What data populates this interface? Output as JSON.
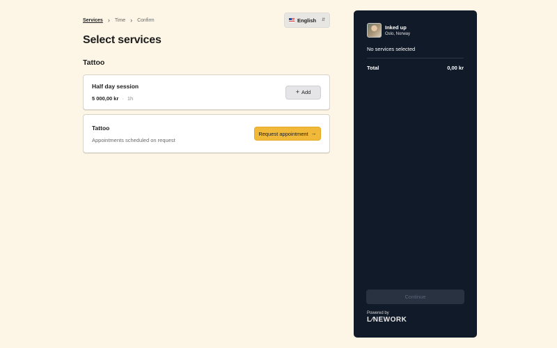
{
  "breadcrumb": {
    "items": [
      {
        "label": "Services",
        "active": true
      },
      {
        "label": "Time",
        "active": false
      },
      {
        "label": "Confirm",
        "active": false
      }
    ],
    "separator": "›"
  },
  "language": {
    "selected": "English",
    "icon": "us-flag-icon",
    "toggle_icon": "up-down-chevron-icon"
  },
  "page_title": "Select services",
  "section": {
    "title": "Tattoo"
  },
  "services": [
    {
      "title": "Half day session",
      "price": "5 000,00 kr",
      "separator": "·",
      "duration": "1h",
      "action_label": "Add",
      "action_icon": "+"
    },
    {
      "title": "Tattoo",
      "description": "Appointments scheduled on request",
      "action_label": "Request appointment",
      "action_icon": "→"
    }
  ],
  "summary": {
    "business_name": "Inked up",
    "location": "Oslo, Norway",
    "empty_text": "No services selected",
    "total_label": "Total",
    "total_value": "0,00 kr",
    "continue_label": "Continue",
    "powered_by": "Powered by",
    "logo_text": "L⁄NEWORK"
  },
  "colors": {
    "page_bg": "#fdf6e6",
    "panel_bg": "#111a28",
    "accent": "#f0b93a"
  }
}
